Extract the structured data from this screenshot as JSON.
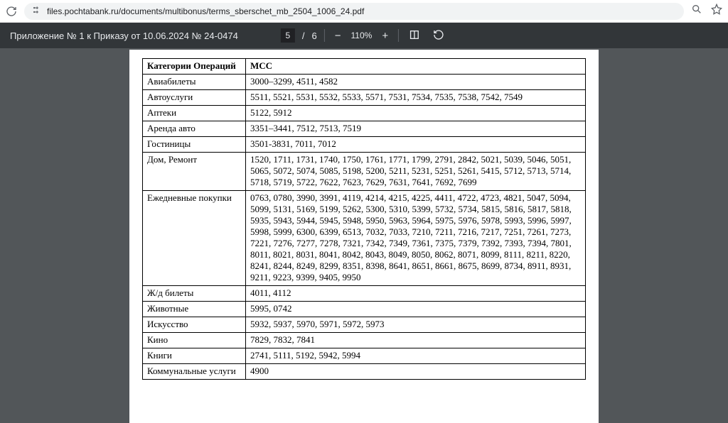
{
  "browser": {
    "url": "files.pochtabank.ru/documents/multibonus/terms_sberschet_mb_2504_1006_24.pdf"
  },
  "pdf": {
    "title": "Приложение № 1 к Приказу от 10.06.2024 № 24-0474",
    "current_page": "5",
    "page_sep": "/",
    "page_count": "6",
    "zoom": "110%"
  },
  "table": {
    "head_cat": "Категории Операций",
    "head_mcc": "МСС",
    "rows": [
      {
        "cat": "Авиабилеты",
        "mcc": "3000–3299, 4511, 4582"
      },
      {
        "cat": "Автоуслуги",
        "mcc": "5511, 5521, 5531, 5532, 5533, 5571,  7531, 7534, 7535, 7538, 7542, 7549"
      },
      {
        "cat": "Аптеки",
        "mcc": "5122, 5912"
      },
      {
        "cat": "Аренда авто",
        "mcc": "3351–3441, 7512, 7513, 7519"
      },
      {
        "cat": "Гостиницы",
        "mcc": "3501-3831, 7011, 7012"
      },
      {
        "cat": "Дом, Ремонт",
        "mcc": "1520, 1711, 1731, 1740, 1750, 1761, 1771, 1799, 2791, 2842, 5021, 5039, 5046, 5051, 5065, 5072, 5074, 5085, 5198, 5200, 5211, 5231, 5251, 5261, 5415, 5712, 5713, 5714, 5718, 5719, 5722, 7622, 7623, 7629, 7631, 7641, 7692, 7699"
      },
      {
        "cat": "Ежедневные покупки",
        "mcc": "0763, 0780, 3990, 3991, 4119, 4214, 4215, 4225, 4411, 4722, 4723, 4821, 5047, 5094, 5099, 5131, 5169, 5199, 5262, 5300, 5310, 5399, 5732, 5734, 5815, 5816, 5817, 5818, 5935, 5943, 5944, 5945, 5948, 5950, 5963, 5964, 5975, 5976, 5978, 5993, 5996, 5997, 5998, 5999, 6300, 6399, 6513, 7032, 7033, 7210, 7211, 7216, 7217, 7251, 7261, 7273, 7221, 7276, 7277, 7278, 7321, 7342, 7349, 7361, 7375, 7379, 7392, 7393, 7394, 7801, 8011, 8021, 8031, 8041, 8042, 8043, 8049, 8050, 8062, 8071, 8099, 8111, 8211, 8220, 8241, 8244, 8249, 8299, 8351, 8398, 8641, 8651, 8661, 8675, 8699, 8734, 8911, 8931, 9211, 9223, 9399, 9405, 9950"
      },
      {
        "cat": "Ж/д билеты",
        "mcc": "4011, 4112"
      },
      {
        "cat": "Животные",
        "mcc": "5995, 0742"
      },
      {
        "cat": "Искусство",
        "mcc": "5932, 5937, 5970, 5971, 5972, 5973"
      },
      {
        "cat": "Кино",
        "mcc": "7829, 7832, 7841"
      },
      {
        "cat": "Книги",
        "mcc": "2741, 5111, 5192, 5942, 5994"
      },
      {
        "cat": "Коммунальные услуги",
        "mcc": "4900"
      }
    ]
  }
}
